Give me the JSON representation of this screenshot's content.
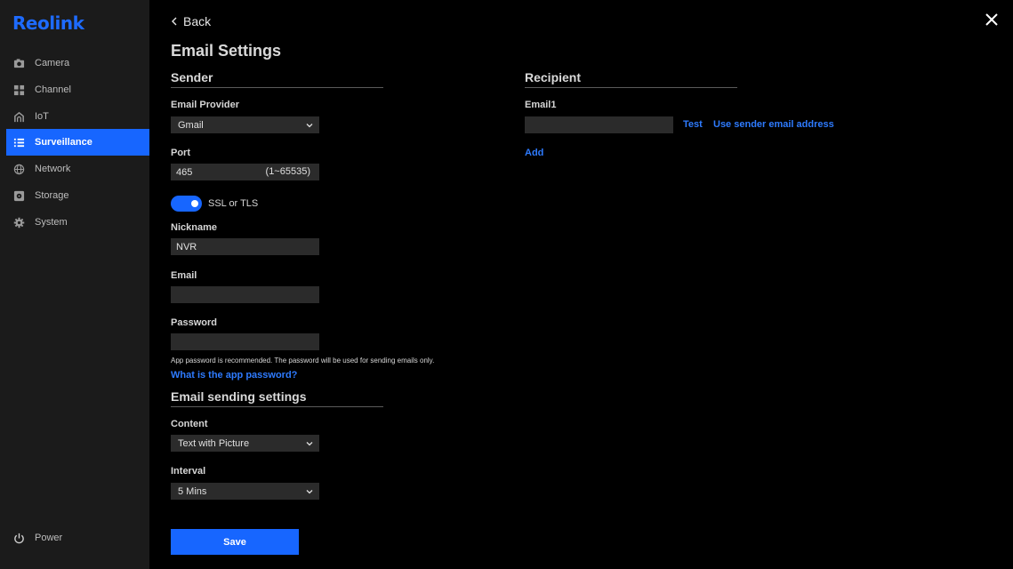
{
  "brand": {
    "logo_text": "Reolink",
    "accent": "#1766ff"
  },
  "sidebar": {
    "items": [
      {
        "label": "Camera",
        "icon": "camera-icon"
      },
      {
        "label": "Channel",
        "icon": "grid-icon"
      },
      {
        "label": "IoT",
        "icon": "iot-icon"
      },
      {
        "label": "Surveillance",
        "icon": "list-icon",
        "active": true
      },
      {
        "label": "Network",
        "icon": "globe-icon"
      },
      {
        "label": "Storage",
        "icon": "storage-icon"
      },
      {
        "label": "System",
        "icon": "gear-icon"
      }
    ],
    "power_label": "Power"
  },
  "header": {
    "back_label": "Back",
    "title": "Email Settings"
  },
  "sender": {
    "title": "Sender",
    "provider_label": "Email Provider",
    "provider_value": "Gmail",
    "port_label": "Port",
    "port_value": "465",
    "port_range": "(1~65535)",
    "ssl_label": "SSL or TLS",
    "ssl_enabled": true,
    "nickname_label": "Nickname",
    "nickname_value": "NVR",
    "email_label": "Email",
    "email_value": "",
    "password_label": "Password",
    "password_value": "",
    "password_hint": "App password is recommended. The password will be used for sending emails only.",
    "app_password_link": "What is the app password?"
  },
  "sending": {
    "title": "Email sending settings",
    "content_label": "Content",
    "content_value": "Text with Picture",
    "interval_label": "Interval",
    "interval_value": "5 Mins"
  },
  "recipient": {
    "title": "Recipient",
    "email1_label": "Email1",
    "email1_value": "",
    "test_label": "Test",
    "use_sender_label": "Use sender email address",
    "add_label": "Add"
  },
  "footer": {
    "save_label": "Save"
  }
}
